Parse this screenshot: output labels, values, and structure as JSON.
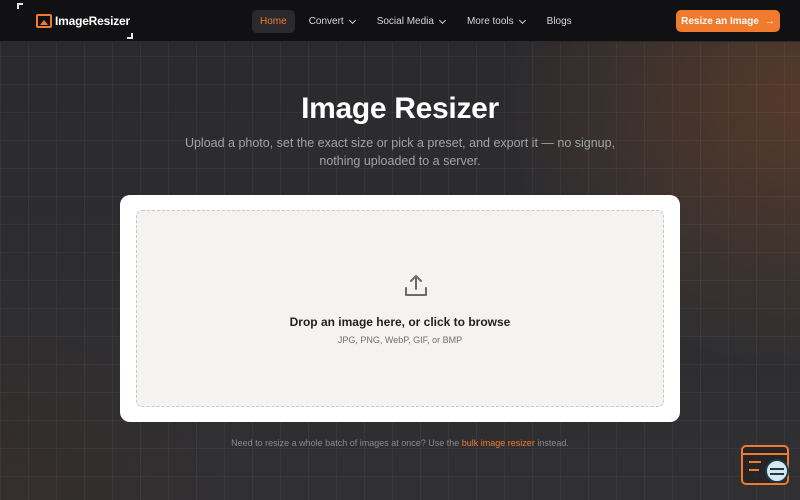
{
  "brand": {
    "name": "ImageResizer"
  },
  "nav": {
    "items": [
      {
        "label": "Home",
        "active": true,
        "dropdown": false
      },
      {
        "label": "Convert",
        "active": false,
        "dropdown": true
      },
      {
        "label": "Social Media",
        "active": false,
        "dropdown": true
      },
      {
        "label": "More tools",
        "active": false,
        "dropdown": true
      },
      {
        "label": "Blogs",
        "active": false,
        "dropdown": false
      }
    ],
    "cta_label": "Resize an Image",
    "cta_icon": "arrow-right-icon"
  },
  "hero": {
    "title": "Image Resizer",
    "subtitle": "Upload a photo, set the exact size or pick a preset, and export it — no signup, nothing uploaded to a server."
  },
  "dropzone": {
    "icon": "upload-icon",
    "main_text": "Drop an image here, or click to browse",
    "formats": "JPG, PNG, WebP, GIF, or BMP"
  },
  "footer_note": {
    "prefix": "Need to resize a whole batch of images at once? Use the",
    "link": "bulk image resizer",
    "suffix": "instead."
  },
  "colors": {
    "accent": "#f07b2e",
    "nav_bg": "#111113",
    "page_bg": "#2c2c2f"
  }
}
